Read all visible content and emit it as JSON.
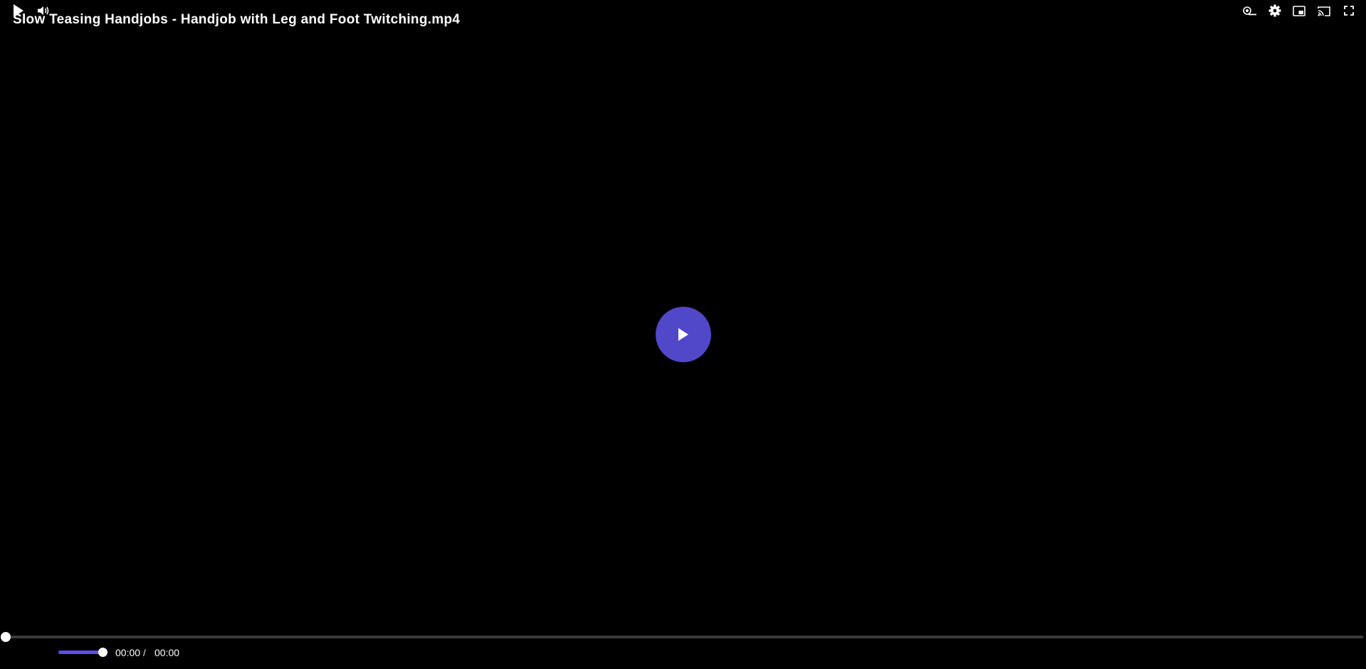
{
  "video": {
    "title": "Slow Teasing Handjobs - Handjob with Leg and Foot Twitching.mp4",
    "current_time": "00:00",
    "separator": "/",
    "duration": "00:00",
    "progress_fraction": 0.0,
    "volume_fraction": 1.0
  },
  "icons": {
    "big_play": "play-icon",
    "play": "play-icon",
    "volume": "volume-icon",
    "autoplay": "autoplay-toggle-icon",
    "settings": "gear-icon",
    "pip": "picture-in-picture-icon",
    "cast": "cast-icon",
    "fullscreen": "fullscreen-icon"
  },
  "colors": {
    "accent": "#5a51e8",
    "big_play_bg": "#5047c9",
    "background": "#000000",
    "track": "#3a3a3a"
  }
}
